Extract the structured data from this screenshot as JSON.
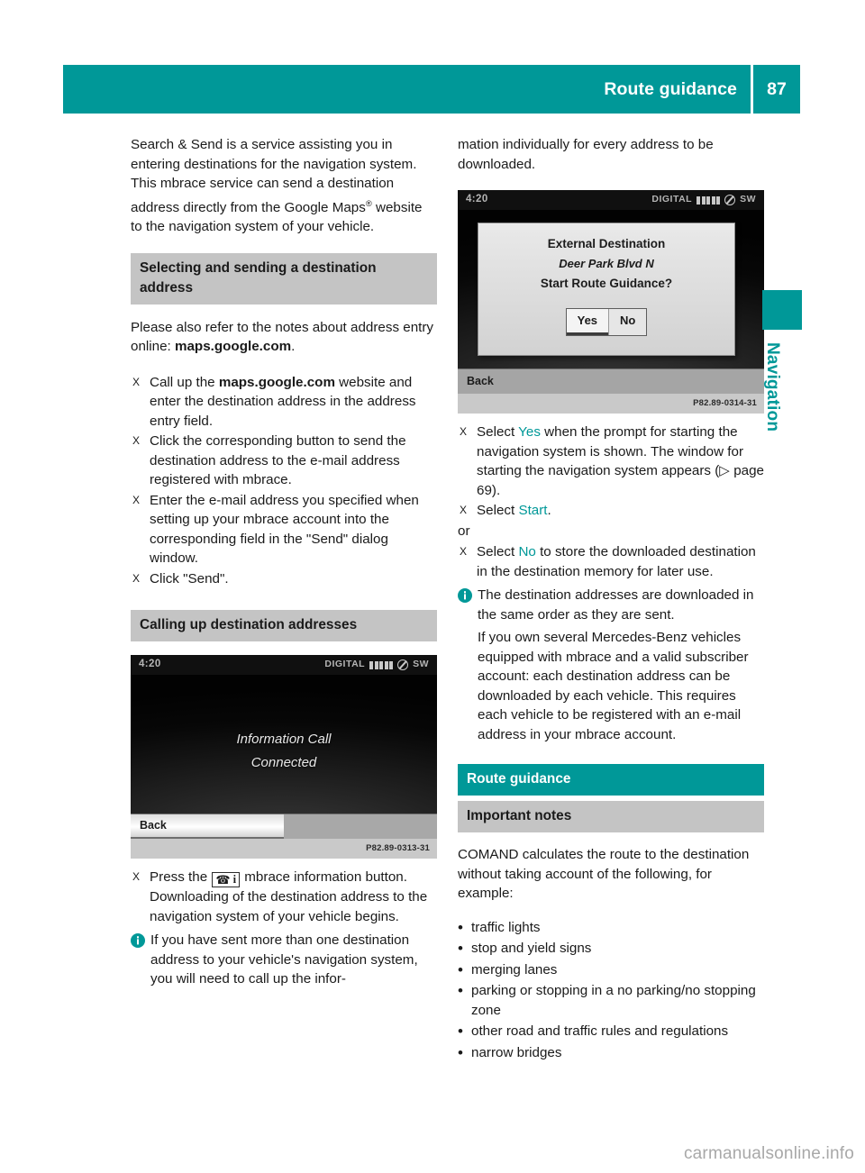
{
  "header": {
    "title": "Route guidance",
    "page_number": "87",
    "accent_color": "#009898"
  },
  "side_tab": {
    "label": "Navigation",
    "color": "#009898"
  },
  "watermark": "carmanualsonline.info",
  "left_column": {
    "intro": "Search & Send is a service assisting you in entering destinations for the navigation system. This mbrace service can send a destination address directly from the Google Maps",
    "intro_sup": "®",
    "intro_tail": " website to the navigation system of your vehicle.",
    "heading_selecting": "Selecting and sending a destination address",
    "para_notes_pre": "Please also refer to the notes about address entry online: ",
    "para_notes_bold": "maps.google.com",
    "para_notes_post": ".",
    "steps": [
      {
        "marker": "X",
        "pre": "Call up the ",
        "bold": "maps.google.com",
        "post": " website and enter the destination address in the address entry field."
      },
      {
        "marker": "X",
        "pre": "Click the corresponding button to send the destination address to the e-mail address registered with mbrace.",
        "bold": "",
        "post": ""
      },
      {
        "marker": "X",
        "pre": "Enter the e-mail address you specified when setting up your mbrace account into the corresponding field in the \"Send\" dialog window.",
        "bold": "",
        "post": ""
      },
      {
        "marker": "X",
        "pre": "Click \"Send\".",
        "bold": "",
        "post": ""
      }
    ],
    "heading_calling": "Calling up destination addresses",
    "figure": {
      "clock": "4:20",
      "band": "DIGITAL",
      "source": "SW",
      "line1": "Information Call",
      "line2": "Connected",
      "softkey_back": "Back",
      "caption": "P82.89-0313-31"
    },
    "press_step_pre": "Press the ",
    "press_step_key_phone": "☎",
    "press_step_key_i": "i",
    "press_step_post": " mbrace information button. Downloading of the destination address to the navigation system of your vehicle begins.",
    "note": "If you have sent more than one destination address to your vehicle's navigation system, you will need to call up the infor-"
  },
  "right_column": {
    "continuation": "mation individually for every address to be downloaded.",
    "figure": {
      "clock": "4:20",
      "band": "DIGITAL",
      "source": "SW",
      "dialog_title": "External Destination",
      "dialog_address": "Deer Park Blvd N",
      "dialog_question": "Start Route Guidance?",
      "button_yes": "Yes",
      "button_no": "No",
      "softkey_back": "Back",
      "caption": "P82.89-0314-31"
    },
    "steps": [
      {
        "marker": "X",
        "pre": "Select ",
        "teal": "Yes",
        "post": " when the prompt for starting the navigation system is shown. The window for starting the navigation system appears (▷ page 69)."
      },
      {
        "marker": "X",
        "pre": "Select ",
        "teal": "Start",
        "post": "."
      }
    ],
    "or_label": "or",
    "step_no": {
      "marker": "X",
      "pre": "Select ",
      "teal": "No",
      "post": " to store the downloaded destination in the destination memory for later use."
    },
    "note_1": "The destination addresses are downloaded in the same order as they are sent.",
    "note_2": "If you own several Mercedes-Benz vehicles equipped with mbrace and a valid subscriber account: each destination address can be downloaded by each vehicle. This requires each vehicle to be registered with an e-mail address in your mbrace account.",
    "heading_route_guidance": "Route guidance",
    "heading_important_notes": "Important notes",
    "comand_para": "COMAND calculates the route to the destination without taking account of the following, for example:",
    "bullets": [
      "traffic lights",
      "stop and yield signs",
      "merging lanes",
      "parking or stopping in a no parking/no stopping zone",
      "other road and traffic rules and regulations",
      "narrow bridges"
    ]
  }
}
